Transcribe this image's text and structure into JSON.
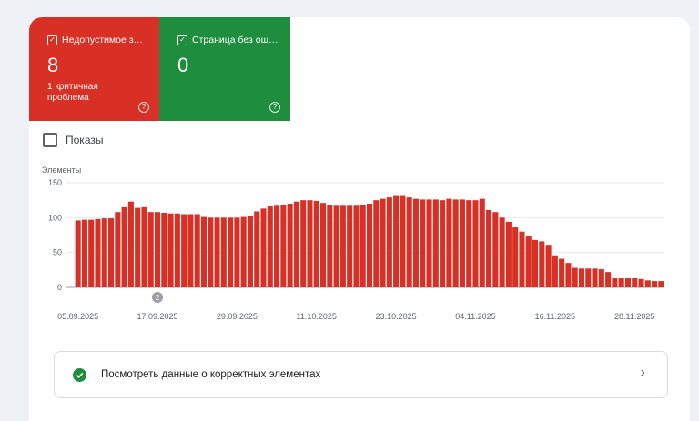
{
  "tiles": {
    "error": {
      "label": "Недопустимое з…",
      "count": "8",
      "sub": "1 критичная проблема",
      "help": "?",
      "color": "#d93025"
    },
    "valid": {
      "label": "Страница без ош…",
      "count": "0",
      "help": "?",
      "color": "#1e8e3e"
    }
  },
  "impressions": {
    "label": "Показы",
    "checked": false
  },
  "chart_data": {
    "type": "bar",
    "ylabel": "Элементы",
    "ylim": [
      0,
      150
    ],
    "yticks": [
      0,
      50,
      100,
      150
    ],
    "grid": true,
    "x_start": "05.09.2025",
    "x_tick_labels": [
      "05.09.2025",
      "17.09.2025",
      "29.09.2025",
      "11.10.2025",
      "23.10.2025",
      "04.11.2025",
      "16.11.2025",
      "28.11.2025"
    ],
    "bar_color": "#d93025",
    "annotation": {
      "label": "2",
      "date": "17.09.2025"
    },
    "values": [
      96,
      97,
      97,
      98,
      99,
      99,
      108,
      115,
      123,
      114,
      115,
      108,
      108,
      107,
      106,
      106,
      105,
      105,
      105,
      101,
      100,
      100,
      100,
      100,
      100,
      101,
      103,
      109,
      113,
      116,
      117,
      118,
      120,
      123,
      125,
      125,
      124,
      121,
      118,
      117,
      117,
      117,
      117,
      118,
      120,
      125,
      127,
      129,
      131,
      131,
      129,
      127,
      126,
      126,
      126,
      125,
      127,
      126,
      126,
      125,
      125,
      127,
      111,
      108,
      100,
      94,
      86,
      80,
      73,
      68,
      66,
      61,
      46,
      41,
      35,
      28,
      27,
      27,
      27,
      26,
      22,
      13,
      13,
      13,
      13,
      12,
      10,
      9,
      9
    ]
  },
  "valid_row": {
    "text": "Посмотреть данные о корректных элементах",
    "ok_icon": "check-circle-icon",
    "chevron": "›"
  }
}
